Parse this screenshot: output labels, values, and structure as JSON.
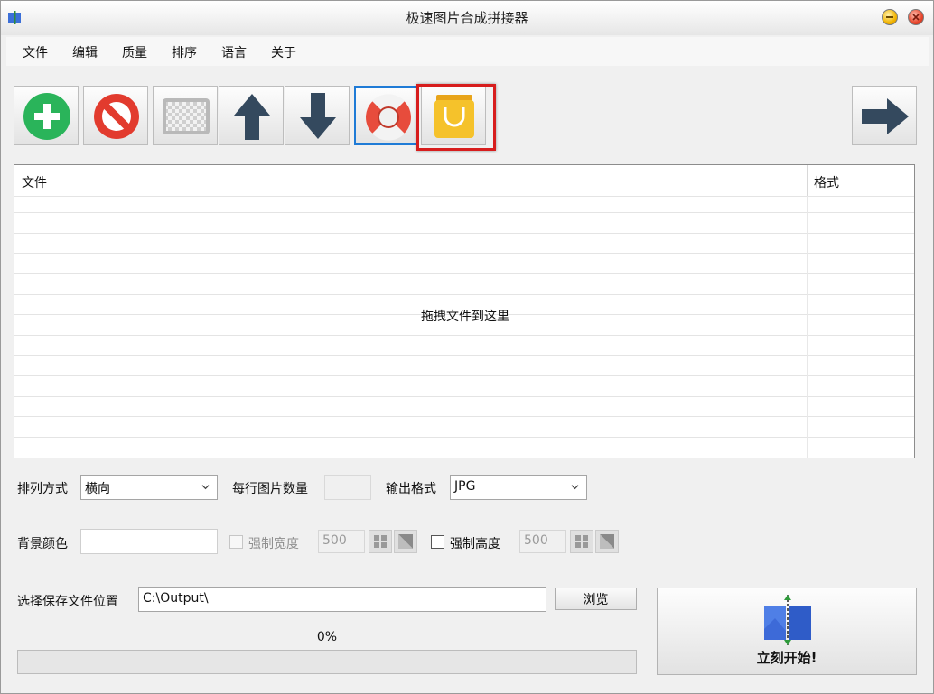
{
  "window": {
    "title": "极速图片合成拼接器"
  },
  "menu": {
    "items": [
      {
        "name": "menu-file",
        "label": "文件"
      },
      {
        "name": "menu-edit",
        "label": "编辑"
      },
      {
        "name": "menu-quality",
        "label": "质量"
      },
      {
        "name": "menu-sort",
        "label": "排序"
      },
      {
        "name": "menu-language",
        "label": "语言"
      },
      {
        "name": "menu-about",
        "label": "关于"
      }
    ]
  },
  "toolbar": {
    "buttons": [
      {
        "name": "add-button",
        "icon": "plus-circle-icon",
        "color": "#2ab45a"
      },
      {
        "name": "remove-button",
        "icon": "prohibit-icon",
        "color": "#e23b2e"
      },
      {
        "name": "clear-button",
        "icon": "checkerboard-icon",
        "color": "#b9b9b9"
      },
      {
        "name": "move-up-button",
        "icon": "arrow-up-icon",
        "color": "#34495e"
      },
      {
        "name": "move-down-button",
        "icon": "arrow-down-icon",
        "color": "#34495e"
      },
      {
        "name": "help-button",
        "icon": "lifebuoy-icon",
        "color": "#e74c3c"
      },
      {
        "name": "shop-button",
        "icon": "shopping-bag-icon",
        "color": "#f5c22b"
      }
    ],
    "next_button_icon": "arrow-right-icon"
  },
  "file_table": {
    "columns": [
      "文件",
      "格式"
    ],
    "rows": [],
    "empty_hint": "拖拽文件到这里"
  },
  "options": {
    "arrange_label": "排列方式",
    "arrange_value": "横向",
    "per_row_label": "每行图片数量",
    "per_row_value": "",
    "output_format_label": "输出格式",
    "output_format_value": "JPG",
    "bg_color_label": "背景颜色",
    "bg_color_value": "",
    "force_width_label": "强制宽度",
    "force_width_value": "500",
    "force_width_checked": false,
    "force_height_label": "强制高度",
    "force_height_value": "500",
    "force_height_checked": false
  },
  "save": {
    "label": "选择保存文件位置",
    "path": "C:\\Output\\",
    "browse_label": "浏览"
  },
  "progress": {
    "text": "0%",
    "value": 0
  },
  "start": {
    "label": "立刻开始!"
  }
}
